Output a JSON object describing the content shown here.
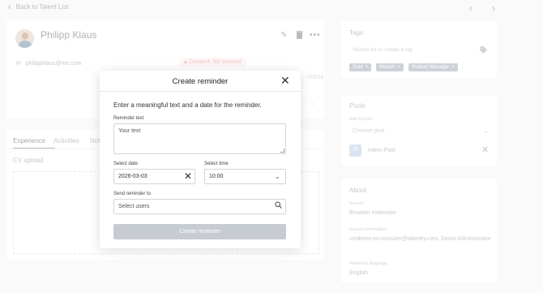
{
  "topbar": {
    "back_label": "Back to Talent List",
    "back_icon": "chevron-left-icon",
    "prev_icon": "chevron-left-icon",
    "next_icon": "chevron-right-icon"
  },
  "candidate": {
    "name": "Philipp Klaus",
    "email": "philippklaus@me.com",
    "consent": "Consent: No consent",
    "date_fragment": "/7/2019"
  },
  "tabs": {
    "items": [
      "Experience",
      "Activities",
      "Not"
    ],
    "active_index": 0
  },
  "cv": {
    "label": "CV upload"
  },
  "tags": {
    "title": "Tags",
    "search_placeholder": "Search for or create a tag",
    "chips": [
      "Gold",
      "Munich",
      "Product Manager"
    ]
  },
  "pools": {
    "title": "Pools",
    "add_label": "Add to pool",
    "select_placeholder": "Choose pool",
    "items": [
      {
        "badge": "IP",
        "name": "Intern Pool"
      }
    ]
  },
  "about": {
    "title": "About",
    "source_label": "Source",
    "source_value": "Browser extension",
    "source_info_label": "Source information",
    "source_info_value": "cmdemo-en.recruiter@talentry.com, Demo Administrator",
    "language_label": "Preferred language",
    "language_value": "English"
  },
  "modal": {
    "title": "Create reminder",
    "intro": "Enter a meaningful text and a date for the reminder.",
    "reminder_text_label": "Reminder text",
    "reminder_text_placeholder": "Your text",
    "date_label": "Select date",
    "date_value": "2026-03-03",
    "time_label": "Select time",
    "time_value": "10:00",
    "send_to_label": "Send reminder to",
    "users_placeholder": "Select users",
    "submit_label": "Create reminder",
    "submit_color": "#c6ccd2"
  }
}
